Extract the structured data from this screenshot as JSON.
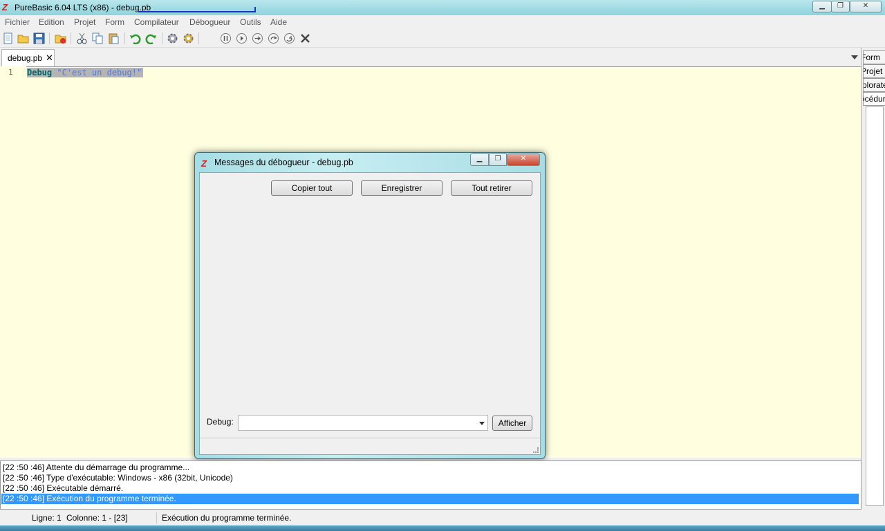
{
  "window": {
    "title": "PureBasic 6.04 LTS (x86) - debug.pb"
  },
  "menu": [
    "Fichier",
    "Edition",
    "Projet",
    "Form",
    "Compilateur",
    "Débogueur",
    "Outils",
    "Aide"
  ],
  "toolbar": {
    "icons": [
      "new-file-icon",
      "open-file-icon",
      "save-icon",
      "close-file-icon",
      "cut-icon",
      "copy-icon",
      "paste-icon",
      "undo-icon",
      "redo-icon",
      "compile-icon",
      "compile-settings-icon",
      "debugger-icon",
      "pause-icon",
      "continue-icon",
      "step-icon",
      "step-over-icon",
      "step-out-icon",
      "kill-icon"
    ]
  },
  "tabs": [
    {
      "label": "debug.pb",
      "close": "✕"
    }
  ],
  "editor": {
    "line_number": "1",
    "keyword": "Debug",
    "string": "\"C'est un debug!\""
  },
  "right_panel": {
    "tabs": [
      "Form",
      "Projet",
      "Explorateur",
      "Procédures"
    ]
  },
  "debug_window": {
    "title": "Messages du débogueur - debug.pb",
    "copy_all": "Copier tout",
    "save": "Enregistrer",
    "clear_all": "Tout retirer",
    "debug_label": "Debug:",
    "debug_value": "",
    "show_button": "Afficher"
  },
  "log": [
    "[22 :50 :46] Attente du démarrage du programme...",
    "[22 :50 :46] Type d'exécutable: Windows - x86  (32bit, Unicode)",
    "[22 :50 :46] Exécutable démarré.",
    "[22 :50 :46] Exécution du programme terminée."
  ],
  "statusbar": {
    "line": "Ligne: 1",
    "column": "Colonne: 1 - [23]",
    "message": "Exécution du programme terminée."
  },
  "colors": {
    "editor_bg": "#ffffe0",
    "selection": "#3399ff",
    "caption": "#a5dde5"
  }
}
